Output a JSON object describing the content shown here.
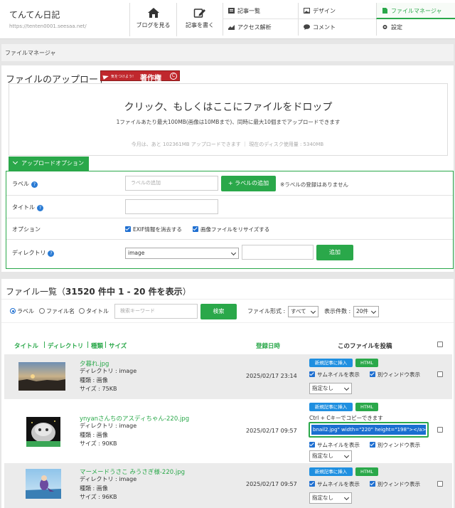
{
  "header": {
    "blog_title": "てんてん日記",
    "blog_url": "https://tenten0001.seesaa.net/",
    "btn_view": "ブログを見る",
    "btn_write": "記事を書く",
    "menu": {
      "articles": "記事一覧",
      "design": "デザイン",
      "file_manager": "ファイルマネージャ",
      "access": "アクセス解析",
      "comments": "コメント",
      "settings": "設定"
    }
  },
  "breadcrumb": "ファイルマネージャ",
  "upload": {
    "heading": "ファイルのアップロード",
    "badge_small": "気をつけよう!",
    "badge_big": "著作権",
    "badge_mark": "C",
    "drop_title": "クリック、もしくはここにファイルをドロップ",
    "drop_sub": "1ファイルあたり最大100MB(画像は10MBまで)、同時に最大10個までアップロードできます",
    "quota": "今月は、あと 102361MB アップロードできます ｜ 現在のディスク使用量 : 5340MB",
    "options_tab": "アップロードオプション",
    "label_row": {
      "label": "ラベル",
      "placeholder": "ラベルの追加",
      "add_button": "+ ラベルの追加",
      "note": "※ラベルの登録はありません"
    },
    "title_row": {
      "label": "タイトル"
    },
    "option_row": {
      "label": "オプション",
      "exif": "EXIF情報を消去する",
      "resize": "画像ファイルをリサイズする"
    },
    "dir_row": {
      "label": "ディレクトリ",
      "selected": "image",
      "add_button": "追加"
    }
  },
  "list": {
    "heading_pre": "ファイル一覧（",
    "heading_bold": "31520 件中 1 - 20 件を表示",
    "heading_post": "）",
    "search": {
      "radio_label": "ラベル",
      "radio_filename": "ファイル名",
      "radio_title": "タイトル",
      "placeholder": "検索キーワード",
      "button": "検索",
      "format_label": "ファイル形式 :",
      "format_value": "すべて",
      "count_label": "表示件数 :",
      "count_value": "20件"
    },
    "columns": {
      "title": "タイトル",
      "directory": "ディレクトリ",
      "type": "種類",
      "size": "サイズ",
      "sep": "|",
      "date": "登録日時",
      "post": "このファイルを投稿"
    },
    "actions": {
      "new_post": "新規記事に挿入",
      "html": "HTML",
      "thumb": "サムネイルを表示",
      "new_window": "別ウィンドウ表示",
      "align": "指定なし",
      "copy_hint": "Ctrl + Cキーでコピーできます"
    },
    "rows": [
      {
        "name": "夕暮れ.jpg",
        "dir": "ディレクトリ : image",
        "type": "種類 : 画像",
        "size": "サイズ : 75KB",
        "date": "2025/02/17 23:14"
      },
      {
        "name": "ynyanさんちのアスディちゃん-220.jpg",
        "dir": "ディレクトリ : image",
        "type": "種類 : 画像",
        "size": "サイズ : 90KB",
        "date": "2025/02/17 09:57",
        "code": "bnail2.jpg\" width=\"220\" height=\"198\"></a>"
      },
      {
        "name": "マーメードうさこ みうさぎ様-220.jpg",
        "dir": "ディレクトリ : image",
        "type": "種類 : 画像",
        "size": "サイズ : 96KB",
        "date": "2025/02/17 09:57"
      }
    ]
  }
}
